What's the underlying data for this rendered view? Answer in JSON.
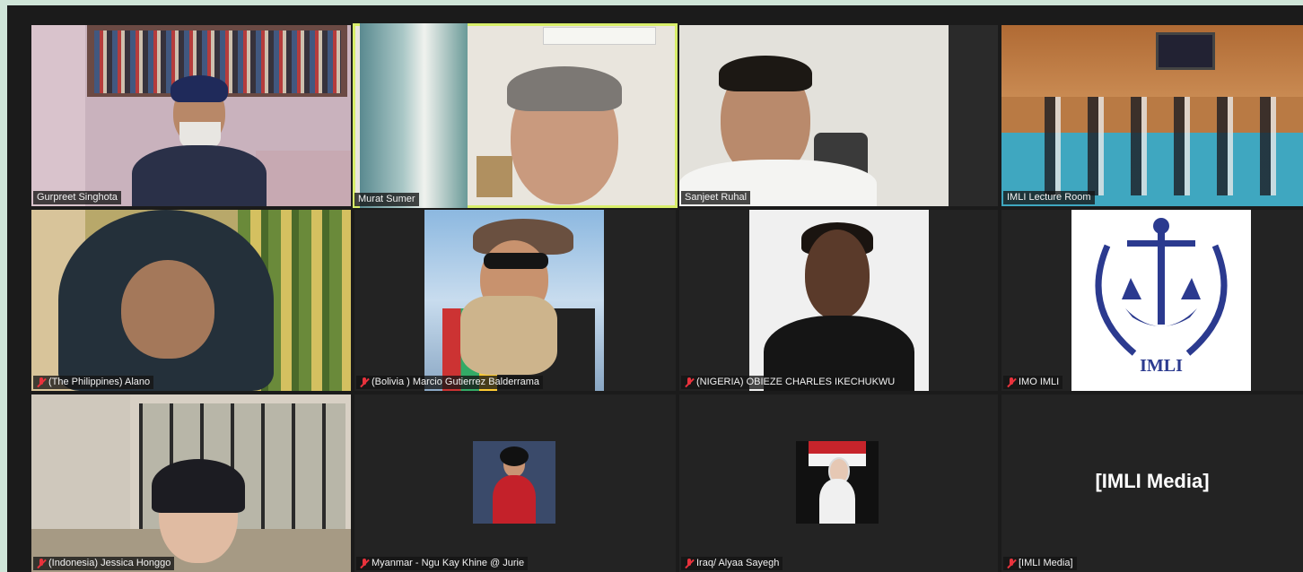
{
  "participants": [
    {
      "label": "Gurpreet Singhota",
      "muted": false
    },
    {
      "label": "Murat Sumer",
      "muted": false,
      "speaking": true
    },
    {
      "label": "Sanjeet Ruhal",
      "muted": false
    },
    {
      "label": "IMLI Lecture Room",
      "muted": false
    },
    {
      "label": "(The Philippines) Alano",
      "muted": true
    },
    {
      "label": "(Bolivia ) Marcio Gutierrez Balderrama",
      "muted": true
    },
    {
      "label": "(NIGERIA) OBIEZE CHARLES IKECHUKWU",
      "muted": true
    },
    {
      "label": "IMO IMLI",
      "muted": true
    },
    {
      "label": "(Indonesia) Jessica Honggo",
      "muted": true
    },
    {
      "label": "Myanmar - Ngu Kay Khine @ Jurie",
      "muted": true
    },
    {
      "label": "Iraq/ Alyaa Sayegh",
      "muted": true
    },
    {
      "label": "[IMLI Media]",
      "muted": true
    }
  ],
  "media_tile": {
    "text": "[IMLI Media]"
  },
  "logo": {
    "text": "IMLI",
    "color": "#2b3a8f"
  },
  "colors": {
    "active_border": "#d8ee6a",
    "muted_icon": "#e8323c",
    "grid_bg": "#1b1b1b"
  }
}
